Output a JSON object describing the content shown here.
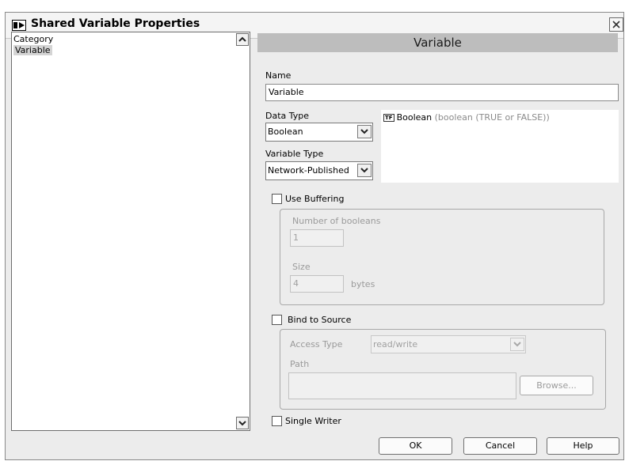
{
  "window": {
    "title": "Shared Variable Properties"
  },
  "category_list": {
    "header": "Category",
    "items": [
      {
        "label": "Variable",
        "selected": true
      }
    ]
  },
  "panel": {
    "header": "Variable",
    "name_label": "Name",
    "name_value": "Variable",
    "data_type_label": "Data Type",
    "data_type_value": "Boolean",
    "type_description_name": "Boolean",
    "type_description_detail": "(boolean (TRUE or FALSE))",
    "type_icon_text": "TF",
    "variable_type_label": "Variable Type",
    "variable_type_value": "Network-Published"
  },
  "buffering": {
    "checkbox_label": "Use Buffering",
    "checked": false,
    "number_label": "Number of booleans",
    "number_value": "1",
    "size_label": "Size",
    "size_value": "4",
    "size_unit": "bytes"
  },
  "bind_source": {
    "checkbox_label": "Bind to Source",
    "checked": false,
    "access_type_label": "Access Type",
    "access_type_value": "read/write",
    "path_label": "Path",
    "path_value": "",
    "browse_label": "Browse..."
  },
  "single_writer": {
    "checkbox_label": "Single Writer",
    "checked": false
  },
  "buttons": {
    "ok": "OK",
    "cancel": "Cancel",
    "help": "Help"
  }
}
